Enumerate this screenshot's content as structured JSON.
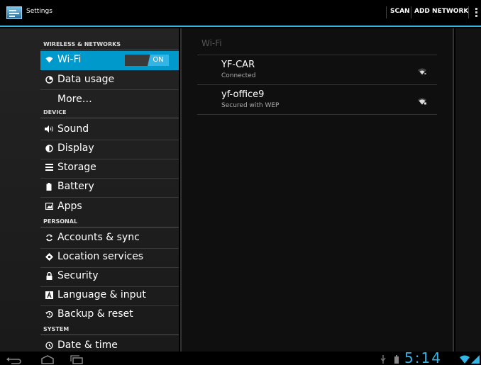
{
  "actionbar": {
    "title": "Settings",
    "scan_label": "SCAN",
    "add_network_label": "ADD NETWORK"
  },
  "sections": {
    "wireless": "WIRELESS & NETWORKS",
    "device": "DEVICE",
    "personal": "PERSONAL",
    "system": "SYSTEM"
  },
  "nav": {
    "wifi": "Wi-Fi",
    "wifi_toggle": "ON",
    "data_usage": "Data usage",
    "more": "More…",
    "sound": "Sound",
    "display": "Display",
    "storage": "Storage",
    "battery": "Battery",
    "apps": "Apps",
    "accounts": "Accounts & sync",
    "location": "Location services",
    "security": "Security",
    "language": "Language & input",
    "backup": "Backup & reset",
    "datetime": "Date & time"
  },
  "wifi_pane": {
    "title": "Wi-Fi",
    "networks": [
      {
        "name": "YF-CAR",
        "status": "Connected"
      },
      {
        "name": "yf-office9",
        "status": "Secured with WEP"
      }
    ]
  },
  "systembar": {
    "clock": "5:14"
  },
  "colors": {
    "accent": "#33b5e5",
    "selected": "#0099cc"
  }
}
